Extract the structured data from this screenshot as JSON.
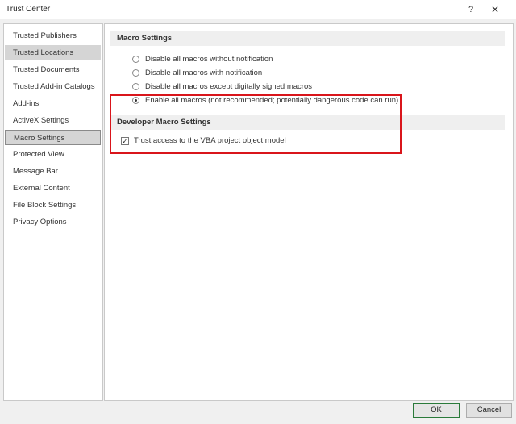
{
  "window": {
    "title": "Trust Center",
    "help_glyph": "?",
    "close_glyph": "✕"
  },
  "sidebar": {
    "items": [
      {
        "label": "Trusted Publishers"
      },
      {
        "label": "Trusted Locations"
      },
      {
        "label": "Trusted Documents"
      },
      {
        "label": "Trusted Add-in Catalogs"
      },
      {
        "label": "Add-ins"
      },
      {
        "label": "ActiveX Settings"
      },
      {
        "label": "Macro Settings"
      },
      {
        "label": "Protected View"
      },
      {
        "label": "Message Bar"
      },
      {
        "label": "External Content"
      },
      {
        "label": "File Block Settings"
      },
      {
        "label": "Privacy Options"
      }
    ]
  },
  "macro_settings": {
    "header": "Macro Settings",
    "options": [
      {
        "label": "Disable all macros without notification",
        "checked": false
      },
      {
        "label": "Disable all macros with notification",
        "checked": false
      },
      {
        "label": "Disable all macros except digitally signed macros",
        "checked": false
      },
      {
        "label": "Enable all macros (not recommended; potentially dangerous code can run)",
        "checked": true
      }
    ]
  },
  "developer_settings": {
    "header": "Developer Macro Settings",
    "trust_vba": {
      "label": "Trust access to the VBA project object model",
      "checked": true
    }
  },
  "buttons": {
    "ok": "OK",
    "cancel": "Cancel"
  },
  "colors": {
    "highlight": "#d9151b",
    "ok_border": "#2a7a3a"
  }
}
